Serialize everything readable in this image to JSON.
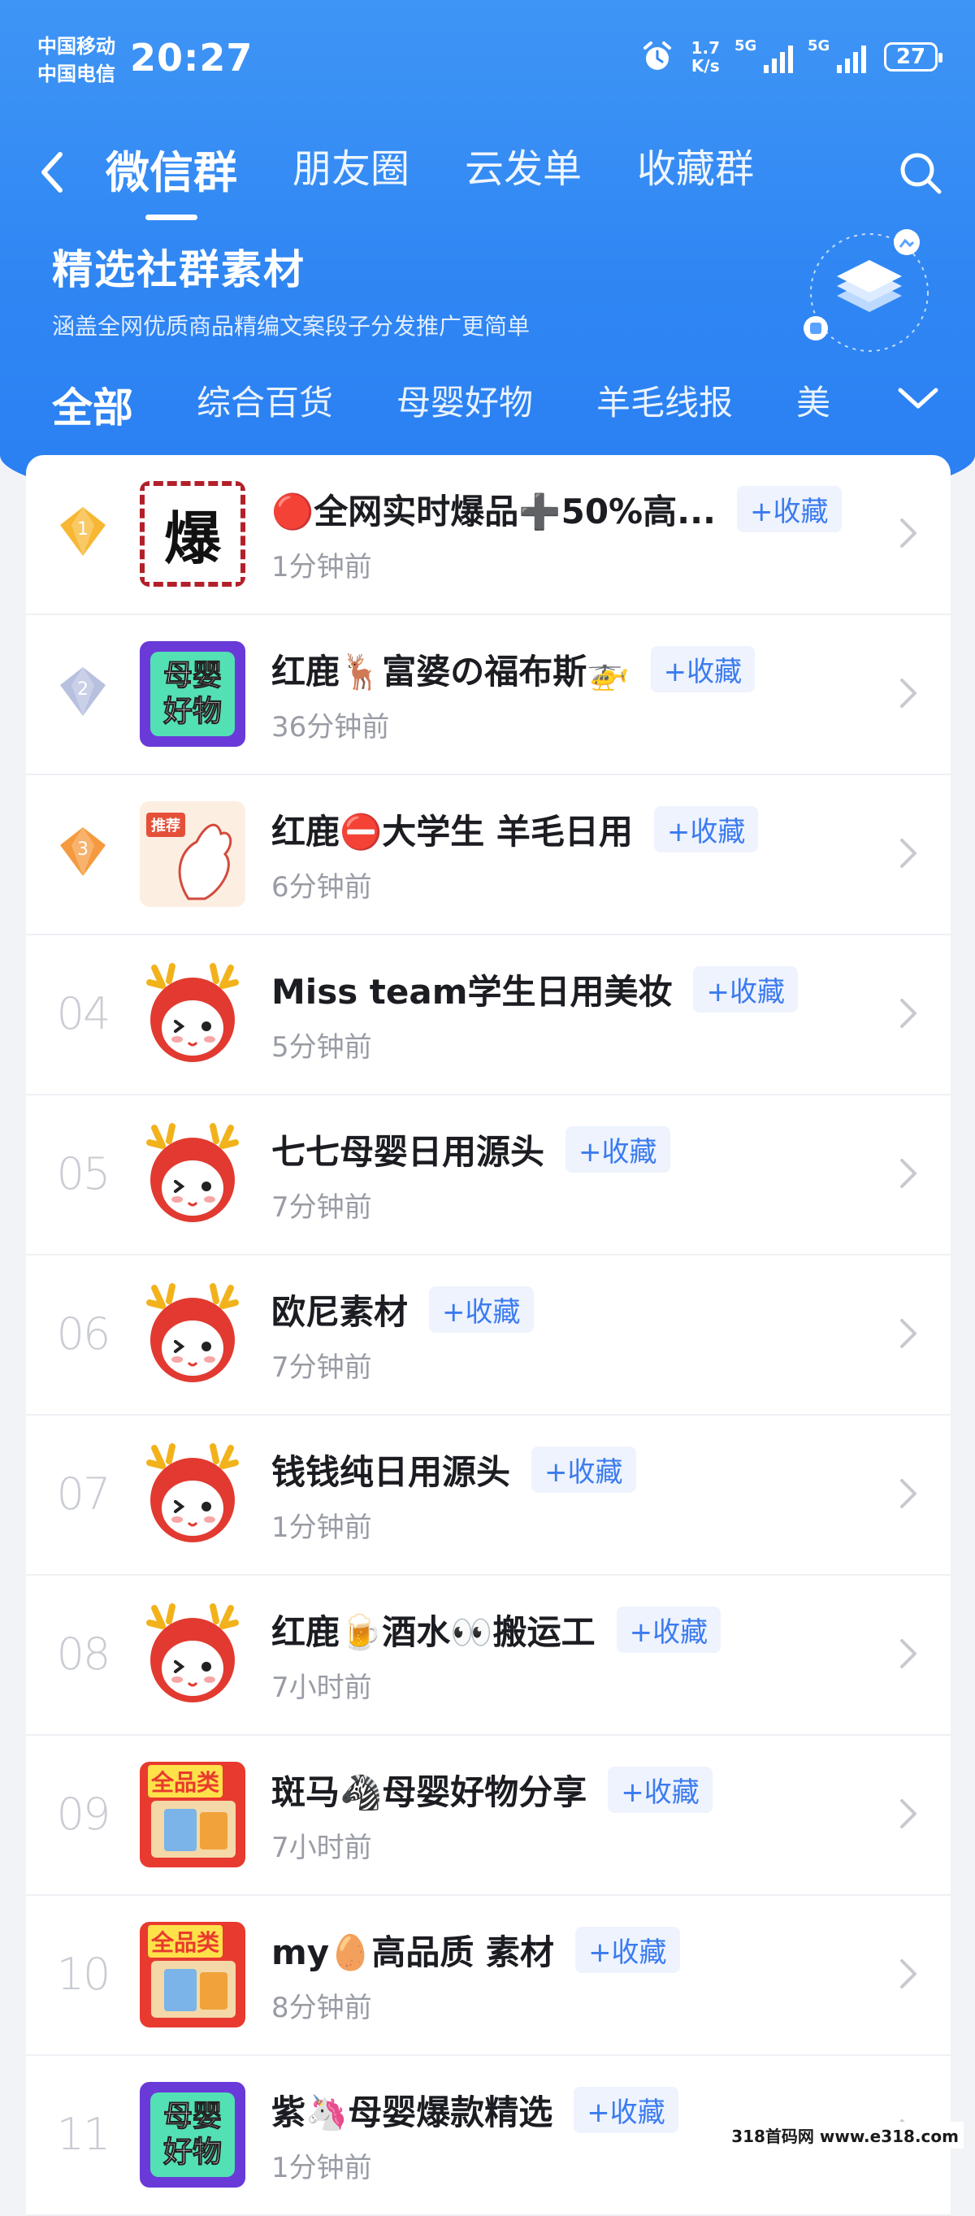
{
  "status_bar": {
    "carrier_1": "中国移动",
    "carrier_2": "中国电信",
    "time": "20:27",
    "speed_value": "1.7",
    "speed_unit": "K/s",
    "network_1": "5G",
    "network_2": "5G",
    "battery": "27"
  },
  "nav": {
    "tabs": [
      {
        "label": "微信群"
      },
      {
        "label": "朋友圈"
      },
      {
        "label": "云发单"
      },
      {
        "label": "收藏群"
      }
    ],
    "active_tab": 0
  },
  "banner": {
    "title": "精选社群素材",
    "subtitle": "涵盖全网优质商品精编文案段子分发推广更简单"
  },
  "categories": [
    {
      "label": "全部"
    },
    {
      "label": "综合百货"
    },
    {
      "label": "母婴好物"
    },
    {
      "label": "羊毛线报"
    },
    {
      "label": "美"
    }
  ],
  "groups": [
    {
      "rank": "1",
      "name": "🔴全网实时爆品➕50%高...",
      "time": "1分钟前",
      "fav": "+收藏",
      "thumb": "bao-icon",
      "rank_style": "gold"
    },
    {
      "rank": "2",
      "name": "红鹿🦌富婆の福布斯🚁",
      "time": "36分钟前",
      "fav": "+收藏",
      "thumb": "muying-icon",
      "rank_style": "silver"
    },
    {
      "rank": "3",
      "name": "红鹿⛔大学生 羊毛日用",
      "time": "6分钟前",
      "fav": "+收藏",
      "thumb": "tuijian-icon",
      "rank_style": "bronze"
    },
    {
      "rank": "04",
      "name": "Miss team学生日用美妆",
      "time": "5分钟前",
      "fav": "+收藏",
      "thumb": "deer-mascot-icon"
    },
    {
      "rank": "05",
      "name": "七七母婴日用源头",
      "time": "7分钟前",
      "fav": "+收藏",
      "thumb": "deer-mascot-icon"
    },
    {
      "rank": "06",
      "name": "欧尼素材",
      "time": "7分钟前",
      "fav": "+收藏",
      "thumb": "deer-mascot-icon"
    },
    {
      "rank": "07",
      "name": "钱钱纯日用源头",
      "time": "1分钟前",
      "fav": "+收藏",
      "thumb": "deer-mascot-icon"
    },
    {
      "rank": "08",
      "name": "红鹿🍺酒水👀搬运工",
      "time": "7小时前",
      "fav": "+收藏",
      "thumb": "deer-mascot-icon"
    },
    {
      "rank": "09",
      "name": "斑马🦓母婴好物分享",
      "time": "7小时前",
      "fav": "+收藏",
      "thumb": "quanpinlei-icon"
    },
    {
      "rank": "10",
      "name": "my🥚高品质 素材",
      "time": "8分钟前",
      "fav": "+收藏",
      "thumb": "quanpinlei-icon"
    },
    {
      "rank": "11",
      "name": "紫🦄母婴爆款精选",
      "time": "1分钟前",
      "fav": "+收藏",
      "thumb": "muying-icon"
    }
  ],
  "thumb_text": {
    "bao": "爆",
    "muying_1": "母婴",
    "muying_2": "好物",
    "tuijian": "推荐",
    "quanpinlei": "全品类"
  },
  "watermark": "318首码网 www.e318.com",
  "colors": {
    "header_blue": "#2f86f3",
    "fav_text": "#3b7bf0",
    "fav_bg": "#eef3fd",
    "gold": "#f7b733",
    "silver": "#b8c0e0",
    "bronze": "#f59a3e"
  }
}
